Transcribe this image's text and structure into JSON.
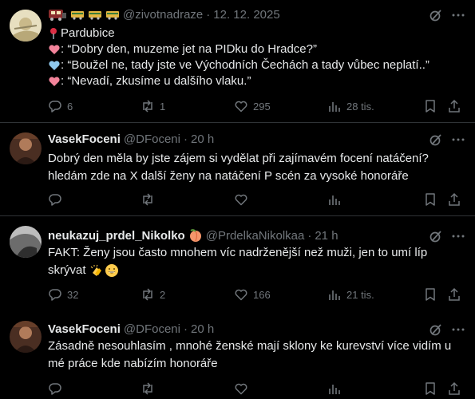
{
  "posts": [
    {
      "handle": "@zivotnadraze",
      "dot": "·",
      "time": "12. 12. 2025",
      "lines": [
        "Pardubice",
        ": “Dobry den, muzeme jet na PIDku do Hradce?”",
        ": “Boužel ne, tady jste ve Východních Čechách a tady vůbec neplatí..”",
        ": “Nevadí, zkusíme u dalšího vlaku.”"
      ],
      "stats": {
        "replies": "6",
        "reposts": "1",
        "likes": "295",
        "views": "28 tis."
      }
    },
    {
      "name": "VasekFoceni",
      "handle": "@DFoceni",
      "dot": "·",
      "time": "20 h",
      "lines": [
        "Dobrý den měla by jste zájem si vydělat při zajímavém focení natáčení?",
        "hledám zde na X další ženy na natáčení P scén za vysoké honoráře"
      ],
      "stats": {
        "replies": "",
        "reposts": "",
        "likes": "",
        "views": ""
      }
    },
    {
      "name": "neukazuj_prdel_Nikolko",
      "handle": "@PrdelkaNikolkaa",
      "dot": "·",
      "time": "21 h",
      "lines": [
        "FAKT: Ženy jsou často mnohem víc nadrženější než muži, jen to umí líp",
        "skrývat"
      ],
      "stats": {
        "replies": "32",
        "reposts": "2",
        "likes": "166",
        "views": "21 tis."
      }
    },
    {
      "name": "VasekFoceni",
      "handle": "@DFoceni",
      "dot": "·",
      "time": "20 h",
      "lines": [
        "Zásadně nesouhlasím , mnohé ženské mají sklony ke kurevství více vidím u",
        "mé práce kde nabízím honoráře"
      ],
      "stats": {
        "replies": "",
        "reposts": "",
        "likes": "",
        "views": ""
      }
    }
  ],
  "colors": {
    "background": "#000000",
    "text": "#e7e9ea",
    "muted": "#71767b",
    "divider": "#2f3336",
    "heart_pink": "#f4849b",
    "heart_blue": "#8fc9ee",
    "pin_red": "#dd2e44"
  },
  "icons": [
    "train-emoji",
    "railcar-emoji",
    "pin-emoji",
    "pink-heart-emoji",
    "light-blue-heart-emoji",
    "peach-emoji",
    "clapping-hands-emoji",
    "grinning-face-emoji",
    "grok-icon",
    "more-icon",
    "reply-icon",
    "repost-icon",
    "like-icon",
    "views-icon",
    "bookmark-icon",
    "share-icon"
  ]
}
